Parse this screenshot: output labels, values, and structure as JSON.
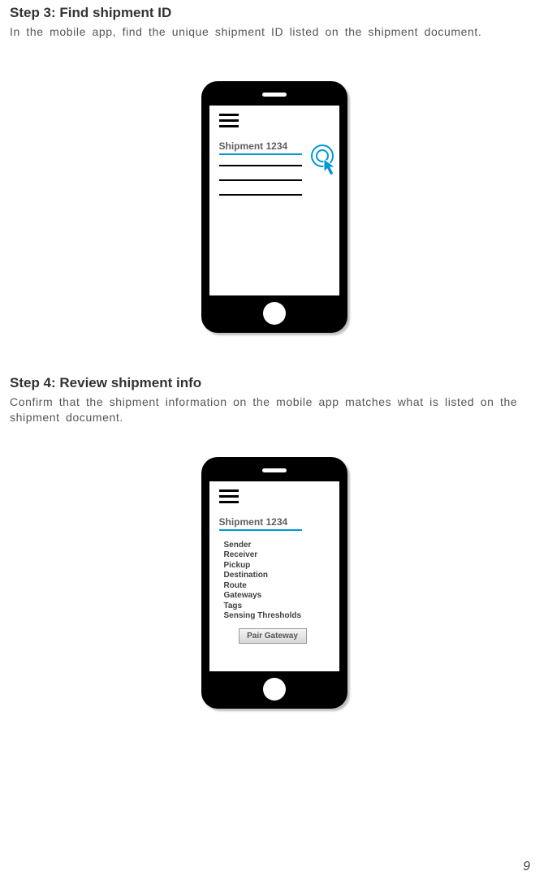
{
  "step3": {
    "title": "Step 3: Find shipment ID",
    "desc": "In the mobile app, find the unique shipment ID listed on the shipment document.",
    "shipment_label": "Shipment 1234"
  },
  "step4": {
    "title": "Step 4: Review shipment info",
    "desc": "Confirm that the shipment information on the mobile app matches what is listed on the shipment document.",
    "shipment_label": "Shipment 1234",
    "fields": {
      "sender": "Sender",
      "receiver": "Receiver",
      "pickup": "Pickup",
      "destination": "Destination",
      "route": "Route",
      "gateways": "Gateways",
      "tags": "Tags",
      "thresholds": "Sensing Thresholds"
    },
    "pair_button": "Pair Gateway"
  },
  "page_number": "9"
}
